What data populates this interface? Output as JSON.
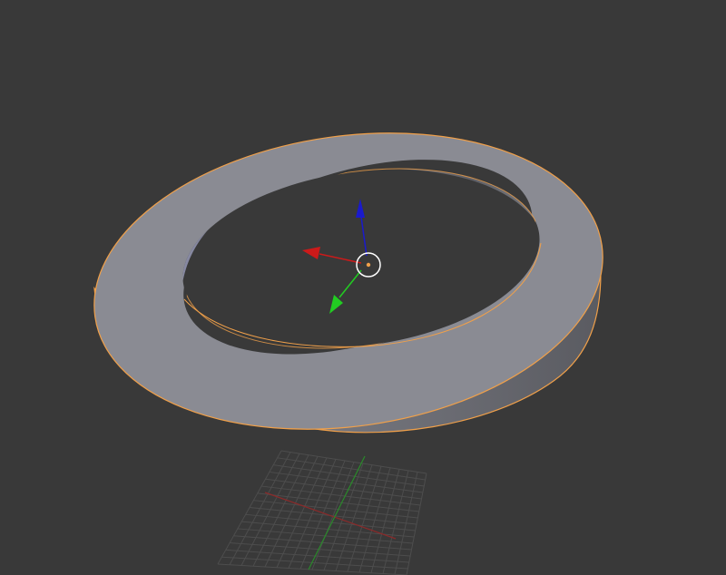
{
  "viewport": {
    "background": "#393939",
    "object": {
      "shape": "ring",
      "selected": true,
      "selection_outline_color": "#f0a04a",
      "surface_color": "#8c8d96"
    },
    "gizmo": {
      "x_axis_color": "#cc1a1a",
      "y_axis_color": "#22cc22",
      "z_axis_color": "#1a1acc",
      "cursor_icon": "3d-cursor-icon"
    },
    "floor_grid": {
      "visible": true,
      "x_axis_color": "#8a2a2a",
      "y_axis_color": "#2a8a2a"
    }
  }
}
